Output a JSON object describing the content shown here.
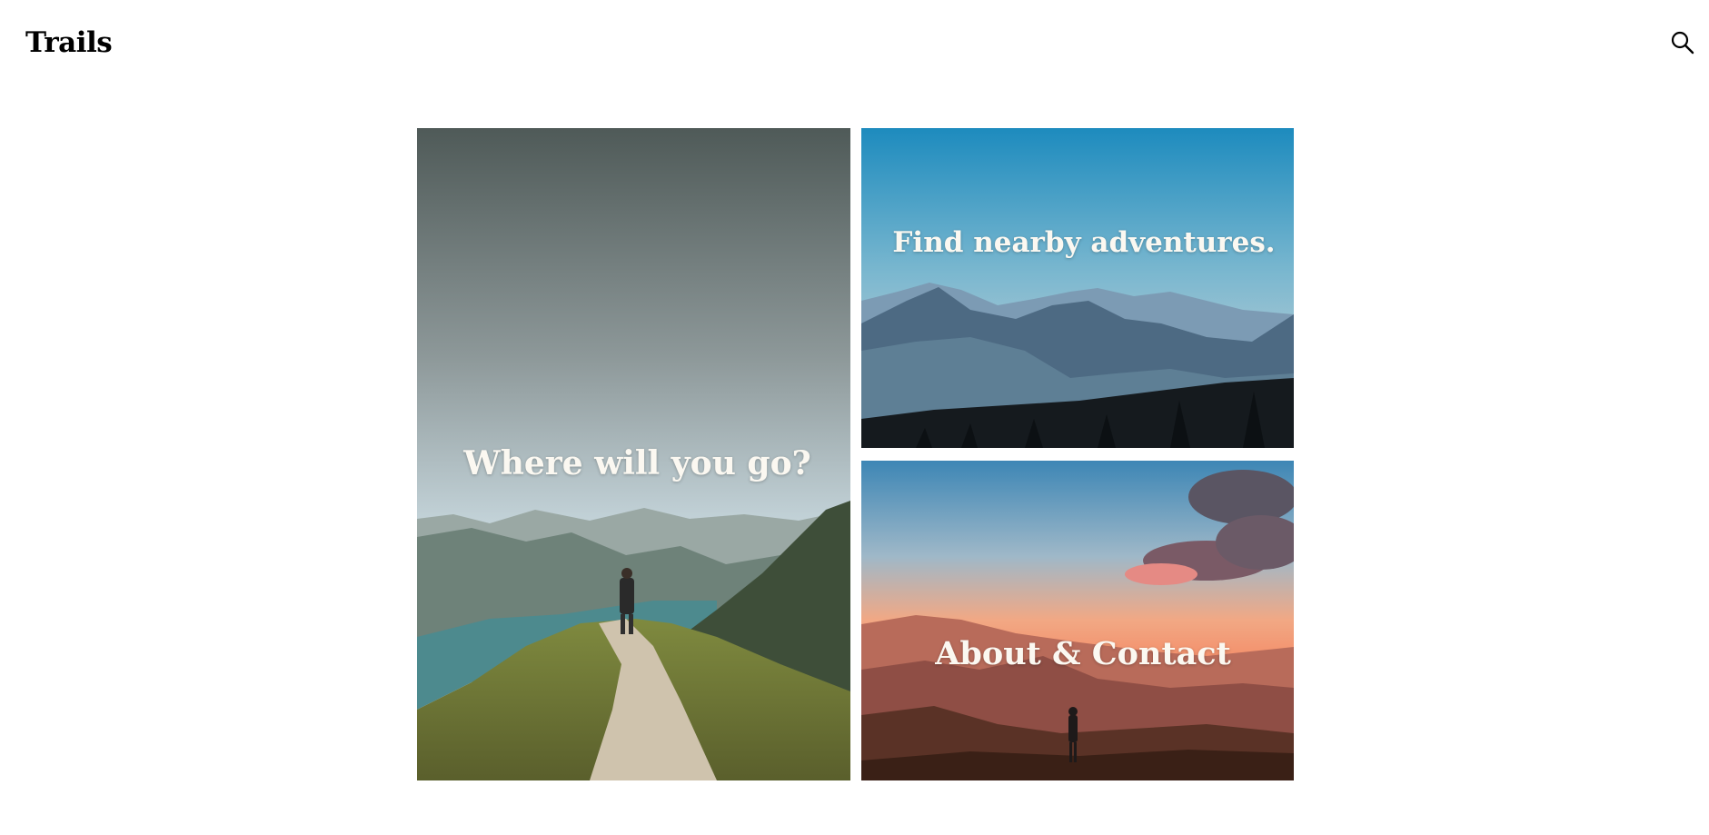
{
  "header": {
    "logo_text": "Trails",
    "search_icon": "search-icon"
  },
  "tiles": [
    {
      "label": "Where will you go?",
      "scene": "hiker on grassy mountain ridge above lake"
    },
    {
      "label": "Find nearby adventures.",
      "scene": "layered blue misty mountain ranges with pine forest"
    },
    {
      "label": "About & Contact",
      "scene": "hiker at sunset with orange sky and clouds over mountains"
    }
  ],
  "colors": {
    "text": "#000000",
    "tile_label": "#fbf8f1",
    "background": "#ffffff"
  }
}
